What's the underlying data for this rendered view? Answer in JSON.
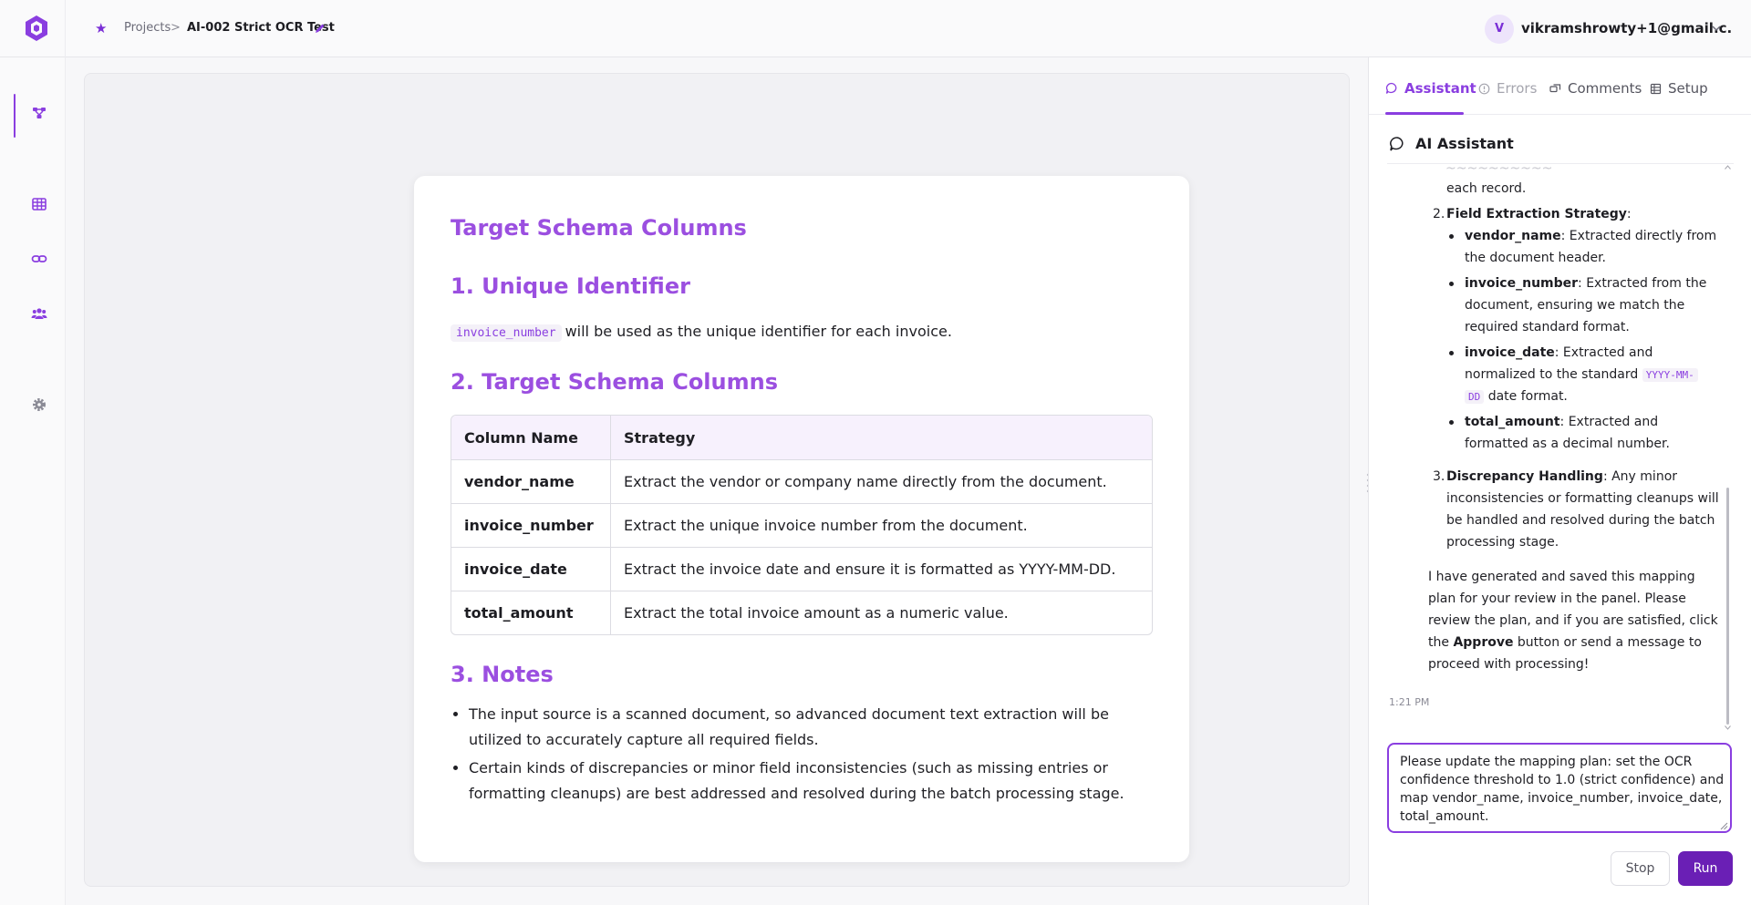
{
  "header": {
    "breadcrumb_root": "Projects",
    "breadcrumb_chevron": ">",
    "project_title": "AI-002 Strict OCR Test",
    "user_initial": "V",
    "user_email": "vikramshrowty+1@gmail.c...",
    "star_glyph": "★"
  },
  "sidebar": {
    "items": [
      {
        "icon": "workflow-icon",
        "active": true
      },
      {
        "icon": "table-icon",
        "active": false
      },
      {
        "icon": "link-icon",
        "active": false
      },
      {
        "icon": "users-icon",
        "active": false
      },
      {
        "icon": "gear-icon",
        "active": false
      }
    ]
  },
  "document": {
    "title": "Target Schema Columns",
    "section1_heading": "1. Unique Identifier",
    "section1_code": "invoice_number",
    "section1_text": "will be used as the unique identifier for each invoice.",
    "section2_heading": "2. Target Schema Columns",
    "table": {
      "headers": [
        "Column Name",
        "Strategy"
      ],
      "rows": [
        [
          "vendor_name",
          "Extract the vendor or company name directly from the document."
        ],
        [
          "invoice_number",
          "Extract the unique invoice number from the document."
        ],
        [
          "invoice_date",
          "Extract the invoice date and ensure it is formatted as YYYY-MM-DD."
        ],
        [
          "total_amount",
          "Extract the total invoice amount as a numeric value."
        ]
      ]
    },
    "section3_heading": "3. Notes",
    "notes": [
      "The input source is a scanned document, so advanced document text extraction will be utilized to accurately capture all required fields.",
      "Certain kinds of discrepancies or minor field inconsistencies (such as missing entries or formatting cleanups) are best addressed and resolved during the batch processing stage."
    ]
  },
  "panel": {
    "tabs": [
      {
        "label": "Assistant",
        "icon": "chat-icon",
        "active": true
      },
      {
        "label": "Errors",
        "icon": "alert-circle-icon",
        "active": false
      },
      {
        "label": "Comments",
        "icon": "comments-icon",
        "active": false
      },
      {
        "label": "Setup",
        "icon": "setup-icon",
        "active": false
      }
    ],
    "assistant_title": "AI Assistant",
    "chat": {
      "cut_line": "each record.",
      "item2_num": "2.",
      "item2_title": "Field Extraction Strategy",
      "item2_colon": ":",
      "fields": [
        {
          "name": "vendor_name",
          "line1": ": Extracted directly from",
          "line2": "the document header."
        },
        {
          "name": "invoice_number",
          "line1": ": Extracted from the",
          "line2": "document, ensuring we match the",
          "line3": "required standard format."
        },
        {
          "name": "invoice_date",
          "line1": ": Extracted and",
          "line2_pre": "normalized to the standard",
          "code1": "YYYY-MM-",
          "code2": "DD",
          "line3_post": "date format."
        },
        {
          "name": "total_amount",
          "line1": ": Extracted and",
          "line2": "formatted as a decimal number."
        }
      ],
      "item3_num": "3.",
      "item3_title": "Discrepancy Handling",
      "item3_line1": ": Any minor",
      "item3_line2": "inconsistencies or formatting cleanups will",
      "item3_line3": "be handled and resolved during the batch",
      "item3_line4": "processing stage.",
      "closing_line1": "I have generated and saved this mapping",
      "closing_line2": "plan for your review in the panel. Please",
      "closing_line3": "review the plan, and if you are satisfied, click",
      "closing_pre": "the",
      "closing_bold": "Approve",
      "closing_post": "button or send a message to",
      "closing_line5": "proceed with processing!",
      "timestamp": "1:21 PM"
    },
    "input": {
      "lines": [
        "Please update the mapping plan: set the OCR",
        "confidence threshold to 1.0 (strict confidence) and",
        "map vendor_name, invoice_number, invoice_date,",
        "total_amount."
      ]
    },
    "stop_label": "Stop",
    "run_label": "Run"
  },
  "colors": {
    "accent": "#8a3ee0",
    "heading": "#9b4fe0",
    "run_button": "#6a1fb5"
  }
}
